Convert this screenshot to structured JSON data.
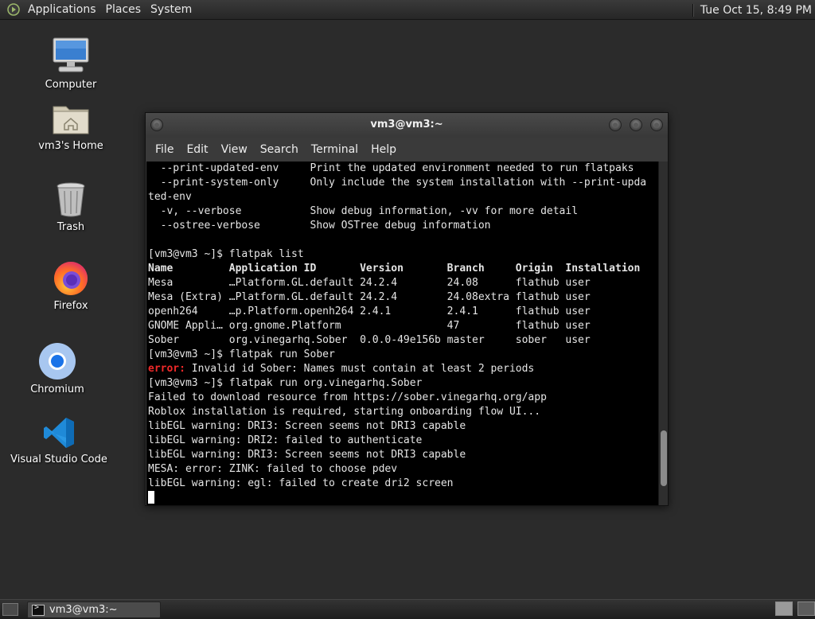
{
  "top_panel": {
    "menus": [
      "Applications",
      "Places",
      "System"
    ],
    "clock": "Tue Oct 15,  8:49 PM"
  },
  "desktop_icons": [
    {
      "label": "Computer",
      "icon": "computer-icon"
    },
    {
      "label": "vm3's Home",
      "icon": "home-folder-icon"
    },
    {
      "label": "Trash",
      "icon": "trash-icon"
    },
    {
      "label": "Firefox",
      "icon": "firefox-icon"
    },
    {
      "label": "Chromium",
      "icon": "chromium-icon"
    },
    {
      "label": "Visual Studio Code",
      "icon": "vscode-icon"
    }
  ],
  "terminal": {
    "title": "vm3@vm3:~",
    "menu": [
      "File",
      "Edit",
      "View",
      "Search",
      "Terminal",
      "Help"
    ],
    "lines": [
      "  --print-updated-env     Print the updated environment needed to run flatpaks",
      "  --print-system-only     Only include the system installation with --print-upda",
      "ted-env",
      "  -v, --verbose           Show debug information, -vv for more detail",
      "  --ostree-verbose        Show OSTree debug information",
      "",
      "[vm3@vm3 ~]$ flatpak list",
      "Name         Application ID       Version       Branch     Origin  Installation",
      "Mesa         …Platform.GL.default 24.2.4        24.08      flathub user",
      "Mesa (Extra) …Platform.GL.default 24.2.4        24.08extra flathub user",
      "openh264     …p.Platform.openh264 2.4.1         2.4.1      flathub user",
      "GNOME Appli… org.gnome.Platform                 47         flathub user",
      "Sober        org.vinegarhq.Sober  0.0.0-49e156b master     sober   user",
      "[vm3@vm3 ~]$ flatpak run Sober",
      "error: Invalid id Sober: Names must contain at least 2 periods",
      "[vm3@vm3 ~]$ flatpak run org.vinegarhq.Sober",
      "Failed to download resource from https://sober.vinegarhq.org/app",
      "Roblox installation is required, starting onboarding flow UI...",
      "libEGL warning: DRI3: Screen seems not DRI3 capable",
      "libEGL warning: DRI2: failed to authenticate",
      "libEGL warning: DRI3: Screen seems not DRI3 capable",
      "MESA: error: ZINK: failed to choose pdev",
      "libEGL warning: egl: failed to create dri2 screen"
    ],
    "error_prefix": "error:",
    "scroll_position": 0.95,
    "scroll_visible_fraction": 0.07
  },
  "taskbar": {
    "task_label": "vm3@vm3:~"
  },
  "colors": {
    "terminal_bg": "#000000",
    "terminal_fg": "#e5e5e5",
    "error": "#ef2929",
    "desktop_bg": "#2b2b2b"
  }
}
